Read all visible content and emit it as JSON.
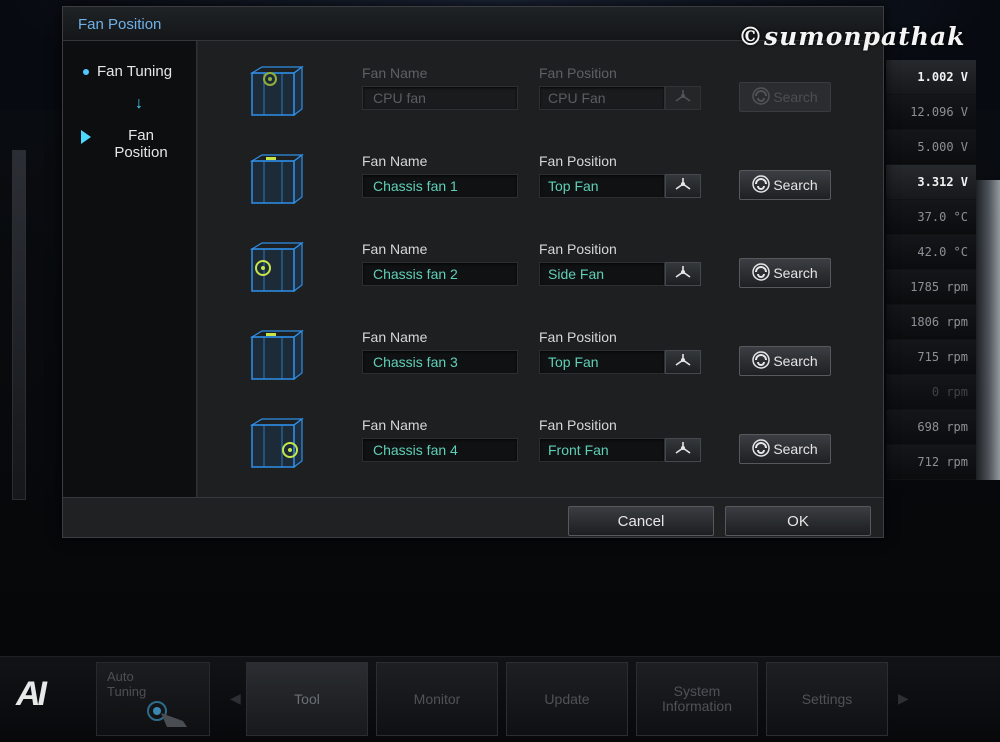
{
  "dialog": {
    "title": "Fan Position",
    "steps": [
      {
        "label": "Fan Tuning"
      },
      {
        "label": "Fan\nPosition"
      }
    ],
    "fans": [
      {
        "name_label": "Fan Name",
        "name": "CPU fan",
        "position_label": "Fan Position",
        "position": "CPU Fan",
        "search_label": "Search",
        "enabled": false,
        "indicator": "front-center"
      },
      {
        "name_label": "Fan Name",
        "name": "Chassis fan 1",
        "position_label": "Fan Position",
        "position": "Top Fan",
        "search_label": "Search",
        "enabled": true,
        "indicator": "top"
      },
      {
        "name_label": "Fan Name",
        "name": "Chassis fan 2",
        "position_label": "Fan Position",
        "position": "Side Fan",
        "search_label": "Search",
        "enabled": true,
        "indicator": "side"
      },
      {
        "name_label": "Fan Name",
        "name": "Chassis fan 3",
        "position_label": "Fan Position",
        "position": "Top Fan",
        "search_label": "Search",
        "enabled": true,
        "indicator": "top"
      },
      {
        "name_label": "Fan Name",
        "name": "Chassis fan 4",
        "position_label": "Fan Position",
        "position": "Front Fan",
        "search_label": "Search",
        "enabled": true,
        "indicator": "front"
      }
    ],
    "cancel_label": "Cancel",
    "ok_label": "OK"
  },
  "readings": [
    {
      "value": "1.002  V",
      "style": "bright"
    },
    {
      "value": "12.096  V",
      "style": "normal"
    },
    {
      "value": "5.000  V",
      "style": "normal"
    },
    {
      "value": "3.312  V",
      "style": "bright"
    },
    {
      "value": "37.0 °C",
      "style": "normal"
    },
    {
      "value": "42.0 °C",
      "style": "normal"
    },
    {
      "value": "1785  rpm",
      "style": "normal"
    },
    {
      "value": "1806  rpm",
      "style": "normal"
    },
    {
      "value": "715  rpm",
      "style": "normal"
    },
    {
      "value": "0  rpm",
      "style": "dim"
    },
    {
      "value": "698  rpm",
      "style": "normal"
    },
    {
      "value": "712  rpm",
      "style": "normal"
    }
  ],
  "bottom_nav": {
    "logo": "AI",
    "auto_tuning": "Auto\nTuning",
    "tabs": [
      "Tool",
      "Monitor",
      "Update",
      "System\nInformation",
      "Settings"
    ]
  },
  "watermark": "©sumonpathak",
  "colors": {
    "accent": "#4fd8ff",
    "field_text": "#5fd0b8",
    "title_text": "#6fb1e8",
    "fan_indicator": "#c7e64a"
  }
}
